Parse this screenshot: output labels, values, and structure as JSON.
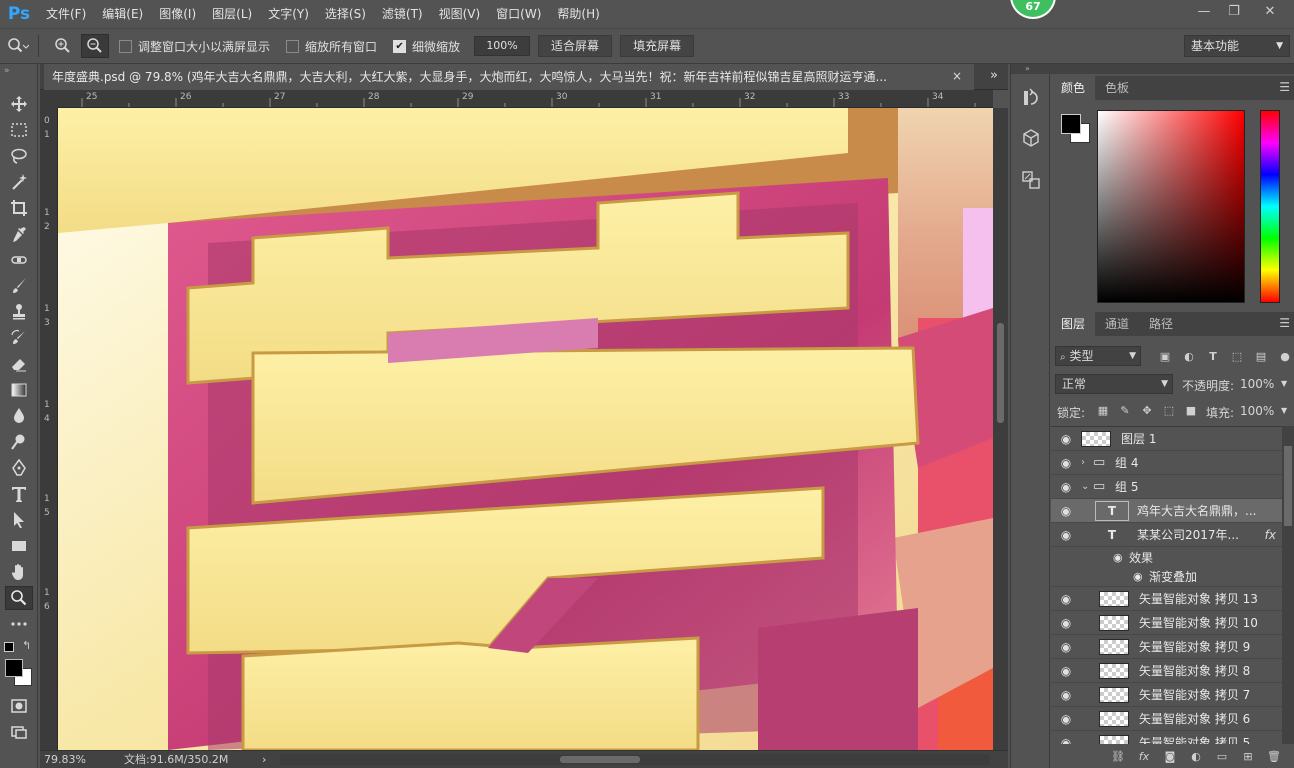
{
  "app": {
    "logo": "Ps",
    "badge": "67"
  },
  "menu": [
    "文件(F)",
    "编辑(E)",
    "图像(I)",
    "图层(L)",
    "文字(Y)",
    "选择(S)",
    "滤镜(T)",
    "视图(V)",
    "窗口(W)",
    "帮助(H)"
  ],
  "options": {
    "resize_windows": "调整窗口大小以满屏显示",
    "zoom_all": "缩放所有窗口",
    "scrubby_zoom": "细微缩放",
    "zoom_value": "100%",
    "fit_screen": "适合屏幕",
    "fill_screen": "填充屏幕",
    "workspace": "基本功能"
  },
  "document": {
    "tab_title": "年度盛典.psd @ 79.8% (鸡年大吉大名鼎鼎，大吉大利，大红大紫，大显身手，大炮而红，大鸣惊人，大马当先！祝：新年吉祥前程似锦吉星高照财运亨通...",
    "close": "×"
  },
  "ruler": {
    "top": [
      "25",
      "26",
      "27",
      "28",
      "29",
      "30",
      "31",
      "32",
      "33",
      "34"
    ],
    "left": [
      "0",
      "1",
      "1",
      "2",
      "1",
      "3",
      "1",
      "4",
      "1",
      "5",
      "1",
      "6"
    ]
  },
  "status": {
    "zoom": "79.83%",
    "doc": "文档:91.6M/350.2M"
  },
  "color_panel": {
    "tabs": [
      "颜色",
      "色板"
    ],
    "foreground": "#000000",
    "background": "#ffffff"
  },
  "layers_panel": {
    "tabs": [
      "图层",
      "通道",
      "路径"
    ],
    "filter": "类型",
    "blend_mode": "正常",
    "opacity_label": "不透明度:",
    "opacity": "100%",
    "lock_label": "锁定:",
    "fill_label": "填充:",
    "fill": "100%",
    "layers": [
      {
        "name": "图层 1",
        "kind": "pixel"
      },
      {
        "name": "组 4",
        "kind": "group"
      },
      {
        "name": "组 5",
        "kind": "group-open"
      },
      {
        "name": "鸡年大吉大名鼎鼎，...",
        "kind": "text",
        "selected": true
      },
      {
        "name": "某某公司2017年...",
        "kind": "text-fx"
      },
      {
        "name": "效果",
        "kind": "effect"
      },
      {
        "name": "渐变叠加",
        "kind": "effect-item"
      },
      {
        "name": "矢量智能对象 拷贝 13",
        "kind": "smart"
      },
      {
        "name": "矢量智能对象 拷贝 10",
        "kind": "smart"
      },
      {
        "name": "矢量智能对象 拷贝 9",
        "kind": "smart"
      },
      {
        "name": "矢量智能对象 拷贝 8",
        "kind": "smart"
      },
      {
        "name": "矢量智能对象 拷贝 7",
        "kind": "smart"
      },
      {
        "name": "矢量智能对象 拷贝 6",
        "kind": "smart"
      },
      {
        "name": "矢量智能对象 拷贝 5",
        "kind": "smart"
      }
    ]
  }
}
